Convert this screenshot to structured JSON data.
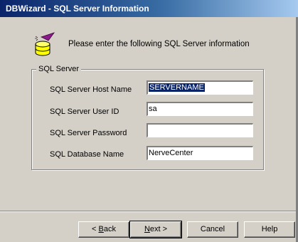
{
  "window": {
    "title": "DBWizard - SQL Server Information"
  },
  "intro": {
    "text": "Please enter the following SQL Server information"
  },
  "group": {
    "legend": "SQL Server"
  },
  "fields": [
    {
      "label": "SQL Server Host Name",
      "value": "SERVERNAME",
      "selected": true
    },
    {
      "label": "SQL Server User ID",
      "value": "sa"
    },
    {
      "label": "SQL Server Password",
      "value": ""
    },
    {
      "label": "SQL Database Name",
      "value": "NerveCenter"
    }
  ],
  "buttons": {
    "back": {
      "mnemonic": "B",
      "rest": "ack",
      "prefix": "< "
    },
    "next": {
      "mnemonic": "N",
      "rest": "ext >"
    },
    "cancel": "Cancel",
    "help": "Help"
  },
  "icons": {
    "wizard": "database-wizard-icon"
  },
  "colors": {
    "title_bar_start": "#0a246a",
    "title_bar_end": "#a6caf0",
    "dialog_face": "#d4d0c8",
    "selection": "#0a246a"
  }
}
